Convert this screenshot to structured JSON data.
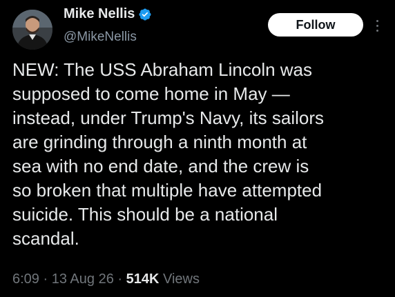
{
  "author": {
    "display_name": "Mike Nellis",
    "handle": "@MikeNellis",
    "verified_icon": "verified-badge-icon",
    "verified_color": "#1d9bf0"
  },
  "follow_button": {
    "label": "Follow"
  },
  "more_menu": {
    "icon": "more-vertical-icon"
  },
  "tweet": {
    "text": "NEW: The USS Abraham Lincoln was\nsupposed to come home in May —\ninstead, under Trump's Navy, its sailors\nare grinding through a ninth month at\nsea with no end date, and the crew is\nso broken that multiple have attempted\nsuicide. This should be a national\nscandal."
  },
  "meta": {
    "time": "6:09",
    "separator": "·",
    "date": "13 Aug 26",
    "views_count": "514K",
    "views_label": "Views"
  },
  "colors": {
    "background": "#000000",
    "primary_text": "#e7e9ea",
    "secondary_text": "#71767b",
    "follow_bg": "#ffffff"
  }
}
